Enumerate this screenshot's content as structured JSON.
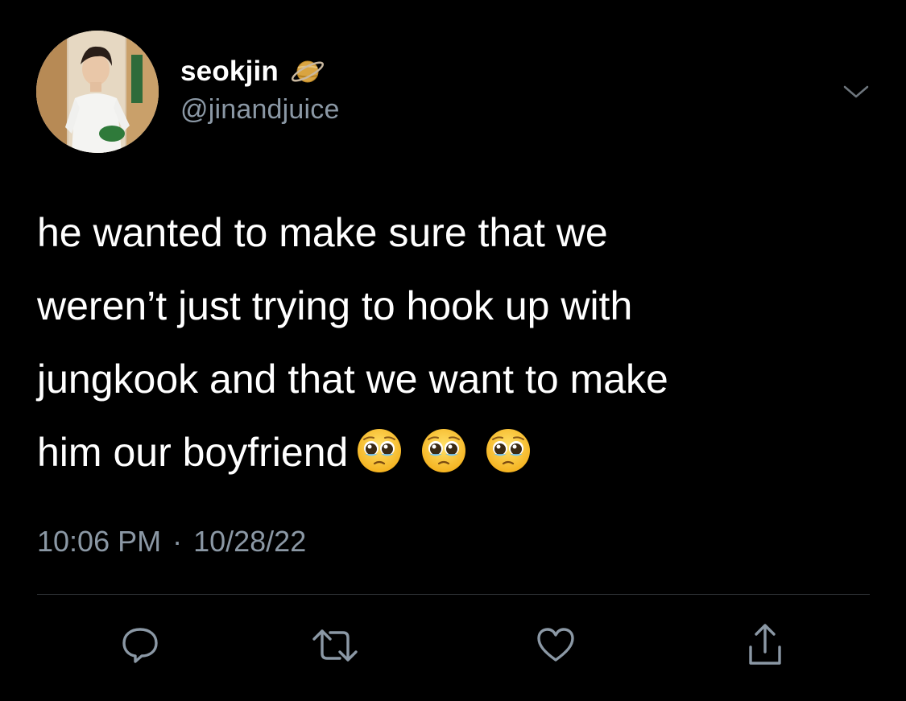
{
  "tweet": {
    "display_name": "seokjin",
    "name_emoji": "ringed-planet-emoji",
    "handle": "@jinandjuice",
    "text_lines": [
      "he wanted to make sure that we",
      "weren’t just trying to hook up with",
      "jungkook and that we want to make",
      "him our boyfriend"
    ],
    "trailing_emojis": [
      "pleading-face-emoji",
      "pleading-face-emoji",
      "pleading-face-emoji"
    ],
    "time": "10:06 PM",
    "separator": "·",
    "date": "10/28/22"
  },
  "actions": [
    {
      "name": "reply",
      "icon": "reply-icon"
    },
    {
      "name": "retweet",
      "icon": "retweet-icon"
    },
    {
      "name": "like",
      "icon": "heart-icon"
    },
    {
      "name": "share",
      "icon": "share-icon"
    }
  ],
  "colors": {
    "background": "#000000",
    "primary_text": "#ffffff",
    "secondary_text": "#8b98a5",
    "divider": "#2f3336",
    "icon": "#8b98a5"
  }
}
